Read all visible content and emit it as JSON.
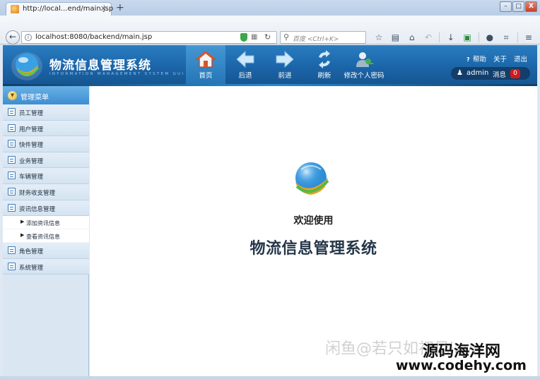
{
  "browser": {
    "tab_title": "http://local...end/main.jsp",
    "tab_close": "×",
    "new_tab": "+",
    "url": "localhost:8080/backend/main.jsp",
    "search_placeholder": "百度 <Ctrl+K>",
    "window_buttons": [
      "–",
      "□",
      "X"
    ]
  },
  "header": {
    "app_title": "物流信息管理系统",
    "app_subtitle": "INFORMATION MANAGEMENT SYSTEM GUI",
    "nav": [
      {
        "label": "首页",
        "icon": "home-icon",
        "active": true
      },
      {
        "label": "后退",
        "icon": "arrow-left-icon"
      },
      {
        "label": "前进",
        "icon": "arrow-right-icon"
      },
      {
        "label": "刷新",
        "icon": "refresh-icon"
      },
      {
        "label": "修改个人密码",
        "icon": "user-key-icon"
      }
    ],
    "links": {
      "help": "帮助",
      "about": "关于",
      "logout": "退出"
    },
    "user": {
      "name": "admin",
      "messages_label": "消息",
      "messages_count": "0"
    }
  },
  "sidebar": {
    "title": "管理菜单",
    "items": [
      {
        "label": "员工管理"
      },
      {
        "label": "用户管理"
      },
      {
        "label": "快件管理"
      },
      {
        "label": "业务管理"
      },
      {
        "label": "车辆管理"
      },
      {
        "label": "财务收支管理"
      },
      {
        "label": "资讯信息管理",
        "expanded": true,
        "children": [
          "添加资讯信息",
          "查看资讯信息"
        ]
      },
      {
        "label": "角色管理"
      },
      {
        "label": "系统管理"
      }
    ]
  },
  "main": {
    "welcome": "欢迎使用",
    "system_name": "物流信息管理系统"
  },
  "watermark": {
    "faint": "闲鱼@若只如初见java",
    "site_cn": "源码海洋网",
    "site_url": "www.codehy.com"
  },
  "colors": {
    "header_blue": "#1b64a8",
    "active_underline": "#5ec84a",
    "badge_red": "#d11a1a",
    "sidebar_bg": "#dae7f3"
  }
}
